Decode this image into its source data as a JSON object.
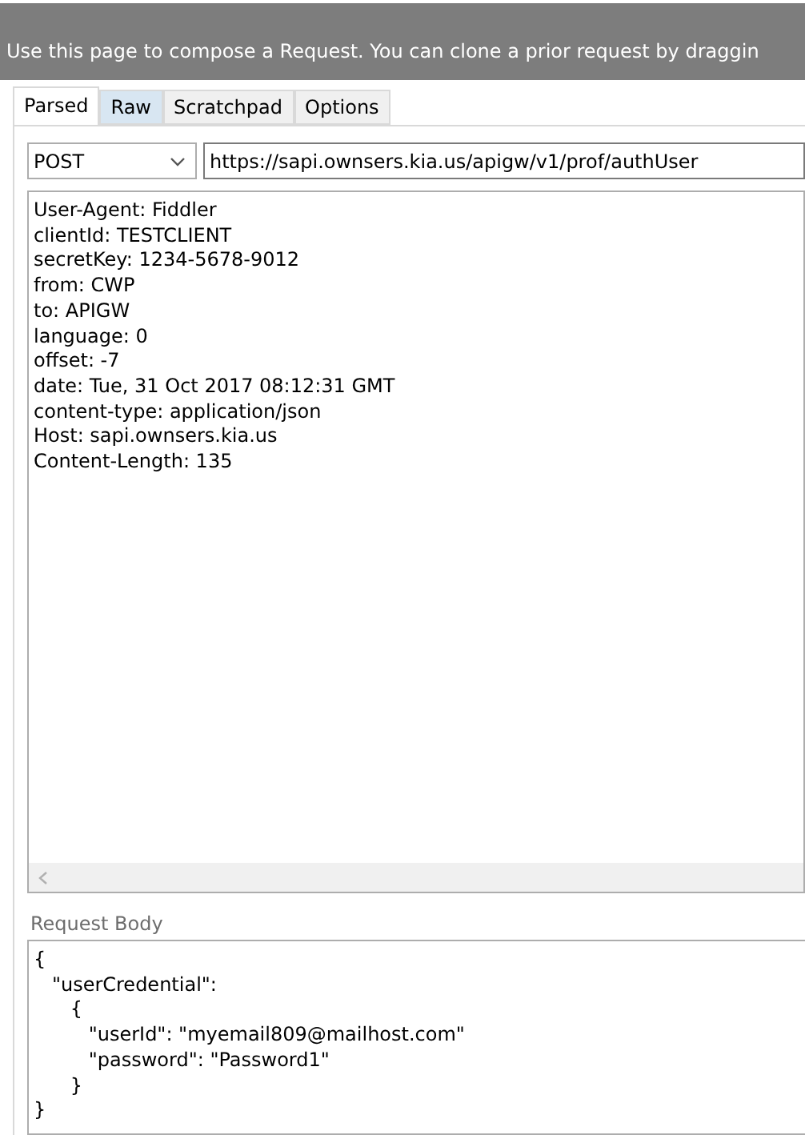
{
  "banner": {
    "text": "Use this page to compose a Request. You can clone a prior request by draggin"
  },
  "tabs": [
    {
      "label": "Parsed",
      "selected": true,
      "hovered": false
    },
    {
      "label": "Raw",
      "selected": false,
      "hovered": true
    },
    {
      "label": "Scratchpad",
      "selected": false,
      "hovered": false
    },
    {
      "label": "Options",
      "selected": false,
      "hovered": false
    }
  ],
  "method": {
    "value": "POST"
  },
  "url": {
    "value": "https://sapi.ownsers.kia.us/apigw/v1/prof/authUser"
  },
  "headers": [
    "User-Agent: Fiddler",
    "clientId: TESTCLIENT",
    "secretKey: 1234-5678-9012",
    "from: CWP",
    "to: APIGW",
    "language: 0",
    "offset: -7",
    "date: Tue, 31 Oct 2017 08:12:31 GMT",
    "content-type: application/json",
    "Host: sapi.ownsers.kia.us",
    "Content-Length: 135"
  ],
  "request_body": {
    "label": "Request Body",
    "value": "{\n   \"userCredential\":\n      {\n         \"userId\": \"myemail809@mailhost.com\"\n         \"password\": \"Password1\"\n      }\n}"
  }
}
